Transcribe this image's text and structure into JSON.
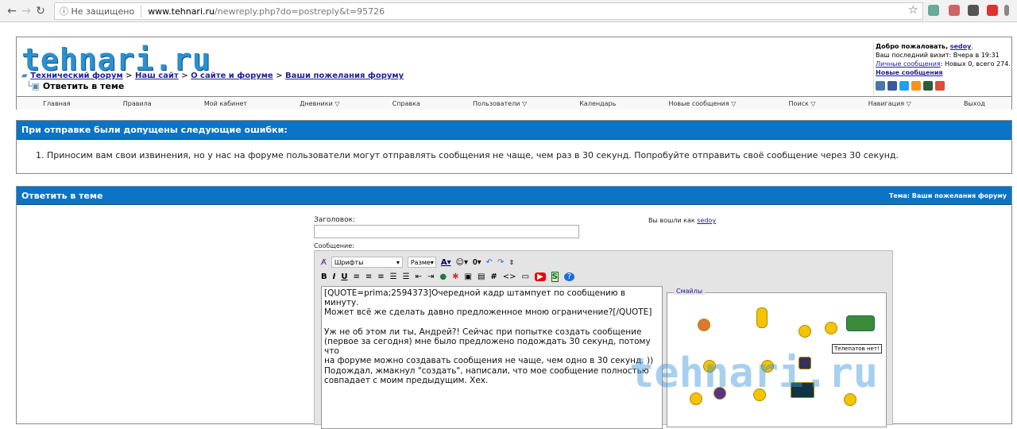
{
  "browser": {
    "security": "Не защищено",
    "domain": "www.tehnari.ru",
    "path": "/newreply.php?do=postreply&t=95726"
  },
  "site": {
    "logo": "tehnari.ru",
    "breadcrumb": [
      "Технический форум",
      "Наш сайт",
      "О сайте и форуме",
      "Ваши пожелания форуму"
    ],
    "current": "Ответить в теме",
    "welcome": {
      "greeting": "Добро пожаловать,",
      "user": "sedoy",
      "last_visit": "Ваш последний визит: Вчера в 19:31",
      "pm_link": "Личные сообщения",
      "pm_text": ": Новых 0, всего 274.",
      "new_posts": "Новые сообщения"
    },
    "nav": [
      "Главная",
      "Правила",
      "Мой кабинет",
      "Дневники ▽",
      "Справка",
      "Пользователи ▽",
      "Календарь",
      "Новые сообщения ▽",
      "Поиск ▽",
      "Навигация ▽",
      "Выход"
    ]
  },
  "error": {
    "title": "При отправке были допущены следующие ошибки:",
    "items": [
      "Приносим вам свои извинения, но у нас на форуме пользователи могут отправлять сообщения не чаще, чем раз в 30 секунд. Попробуйте отправить своё сообщение через 30 секунд."
    ]
  },
  "reply": {
    "title": "Ответить в теме",
    "theme_label": "Тема:",
    "theme": "Ваши пожелания форуму",
    "subject_label": "Заголовок:",
    "subject_value": "",
    "logged_as": "Вы вошли как",
    "logged_user": "sedoy",
    "message_label": "Сообщение:",
    "font_select": "Шрифты",
    "size_select": "Разме",
    "message": "[QUOTE=prima;2594373]Очередной кадр штампует по сообщению в минуту.\nМожет всё же сделать давно предложенное мною ограничение?[/QUOTE]\n\nУж не об этом ли ты, Андрей?! Сейчас при попытке создать сообщение\n(первое за сегодня) мне было предложено подождать 30 секунд, потому что\nна форуме можно создавать сообщения не чаще, чем одно в 30 секунд. ))\nПодождал, жмакнул \"создать\", написали, что мое сообщение полностью\nсовпадает с моим предыдущим. Хех.",
    "smiles_label": "Смайлы",
    "tooltip": "Телепатов нет!"
  },
  "watermark": "tehnari.ru"
}
